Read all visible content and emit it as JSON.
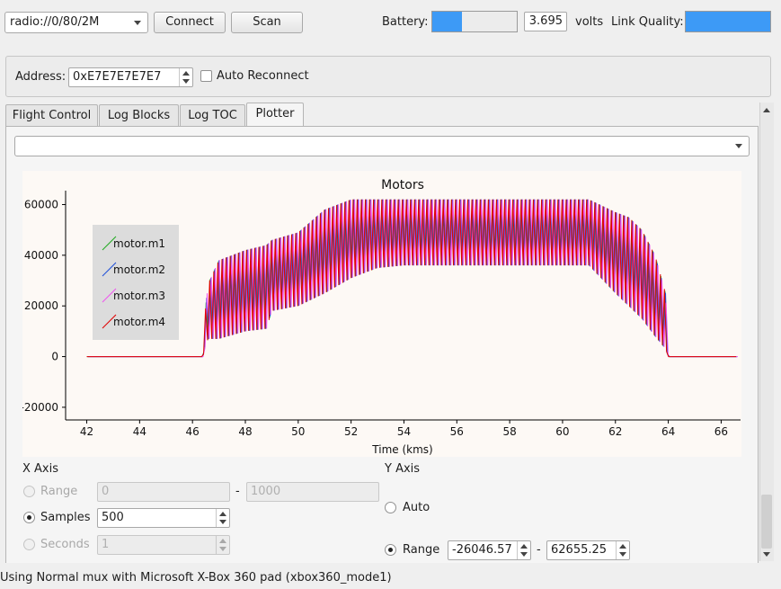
{
  "toolbar": {
    "radio_uri": "radio://0/80/2M",
    "connect_label": "Connect",
    "scan_label": "Scan",
    "battery_label": "Battery:",
    "battery_level_fraction": 0.35,
    "battery_voltage": "3.695",
    "volts_label": "volts",
    "link_quality_label": "Link Quality:",
    "link_quality_fraction": 1.0
  },
  "address_panel": {
    "address_label": "Address:",
    "address_value": "0xE7E7E7E7E7",
    "auto_reconnect_label": "Auto Reconnect",
    "auto_reconnect_checked": false
  },
  "tabs": [
    {
      "label": "Flight Control",
      "active": false
    },
    {
      "label": "Log Blocks",
      "active": false
    },
    {
      "label": "Log TOC",
      "active": false
    },
    {
      "label": "Plotter",
      "active": true
    }
  ],
  "plotter": {
    "config_select_value": ""
  },
  "chart_data": {
    "type": "line",
    "title": "Motors",
    "xlabel": "Time (kms)",
    "ylabel": "",
    "xlim": [
      41.2,
      66.7
    ],
    "ylim": [
      -25000,
      62655
    ],
    "x_ticks": [
      "42",
      "44",
      "46",
      "48",
      "50",
      "52",
      "54",
      "56",
      "58",
      "60",
      "62",
      "64",
      "66"
    ],
    "y_ticks": [
      "60000",
      "40000",
      "20000",
      "0",
      "-20000"
    ],
    "legend_position": "top-left",
    "series": [
      {
        "name": "motor.m1",
        "color": "#22aa22"
      },
      {
        "name": "motor.m2",
        "color": "#1f4fd8"
      },
      {
        "name": "motor.m3",
        "color": "#ee55ee"
      },
      {
        "name": "motor.m4",
        "color": "#e00000"
      }
    ],
    "envelope": {
      "x": [
        41.2,
        46.4,
        46.5,
        46.6,
        47.0,
        48.0,
        48.8,
        49.0,
        50.0,
        51.0,
        52.0,
        53.0,
        54.0,
        56.0,
        58.0,
        60.0,
        61.0,
        62.0,
        62.5,
        63.0,
        63.5,
        63.9,
        64.0,
        66.7
      ],
      "upper": [
        0,
        0,
        20000,
        29000,
        38000,
        42000,
        44000,
        46000,
        49000,
        58000,
        62000,
        62000,
        62000,
        62000,
        62000,
        62000,
        62000,
        57000,
        55000,
        50000,
        40000,
        25000,
        0,
        0
      ],
      "lower": [
        0,
        0,
        5000,
        7000,
        7000,
        10000,
        11000,
        18000,
        20000,
        25000,
        31000,
        35000,
        36000,
        36000,
        36000,
        36000,
        36000,
        25000,
        20000,
        15000,
        8000,
        3000,
        0,
        0
      ]
    },
    "oscillation_period_s": 0.155
  },
  "x_axis_panel": {
    "title": "X Axis",
    "range_label": "Range",
    "range_min": "0",
    "range_max": "1000",
    "range_separator": "-",
    "samples_label": "Samples",
    "samples_value": "500",
    "seconds_label": "Seconds",
    "seconds_value": "1",
    "selected": "samples"
  },
  "y_axis_panel": {
    "title": "Y Axis",
    "auto_label": "Auto",
    "range_label": "Range",
    "range_min": "-26046.57",
    "range_max": "62655.25",
    "range_separator": "-",
    "selected": "range"
  },
  "status_bar": {
    "text": "Using Normal mux with Microsoft X-Box 360 pad (xbox360_mode1)"
  },
  "colors": {
    "accent_blue": "#3d9af6",
    "plot_bg": "#fdf9f5"
  }
}
